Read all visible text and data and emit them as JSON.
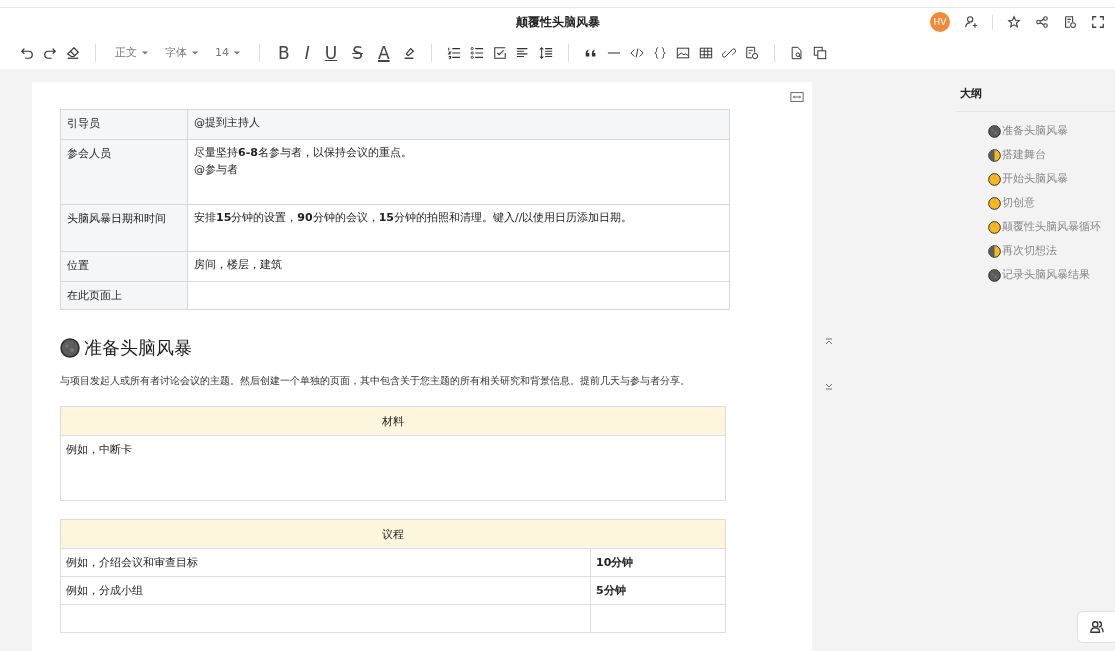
{
  "window": {
    "title": "颠覆性头脑风暴"
  },
  "header": {
    "avatar": "HV"
  },
  "toolbar": {
    "style": "正文",
    "font": "字体",
    "size": "14",
    "format_buttons": [
      {
        "kind": "bold",
        "label": "B"
      },
      {
        "kind": "italic",
        "label": "I"
      },
      {
        "kind": "underline",
        "label": "U"
      },
      {
        "kind": "strike",
        "label": "S"
      },
      {
        "kind": "color",
        "label": "A"
      }
    ]
  },
  "info_table": [
    {
      "label": "引导员",
      "lines": [
        "@提到主持人"
      ]
    },
    {
      "label": "参会人员",
      "lines": [
        "尽量坚持**6-8**名参与者，以保持会议的重点。",
        "@参与者"
      ]
    },
    {
      "label": "头脑风暴日期和时间",
      "lines": [
        "安排**15**分钟的设置，**90**分钟的会议，**15**分钟的拍照和清理。键入//以使用日历添加日期。"
      ]
    },
    {
      "label": "位置",
      "lines": [
        "房间，楼层，建筑"
      ]
    },
    {
      "label": "在此页面上"
    }
  ],
  "section": {
    "heading": "准备头脑风暴",
    "kind": "new",
    "paragraph": "与项目发起人或所有者讨论会议的主题。然后创建一个单独的页面，其中包含关于您主题的所有相关研究和背景信息。提前几天与参与者分享。"
  },
  "materials": {
    "heading": "材料",
    "body": "例如，中断卡"
  },
  "agenda": {
    "heading": "议程",
    "rows": [
      {
        "item": "例如，介绍会议和审查目标",
        "time": "10分钟"
      },
      {
        "item": "例如，分成小组",
        "time": "5分钟"
      }
    ]
  },
  "outline": {
    "title": "大纲",
    "items": [
      {
        "label": "准备头脑风暴",
        "kind": "new"
      },
      {
        "label": "搭建舞台",
        "kind": "half"
      },
      {
        "label": "开始头脑风暴",
        "kind": "full"
      },
      {
        "label": "切创意",
        "kind": "full"
      },
      {
        "label": "颠覆性头脑风暴循环",
        "kind": "full"
      },
      {
        "label": "再次切想法",
        "kind": "half"
      },
      {
        "label": "记录头脑风暴结果",
        "kind": "new"
      }
    ]
  }
}
